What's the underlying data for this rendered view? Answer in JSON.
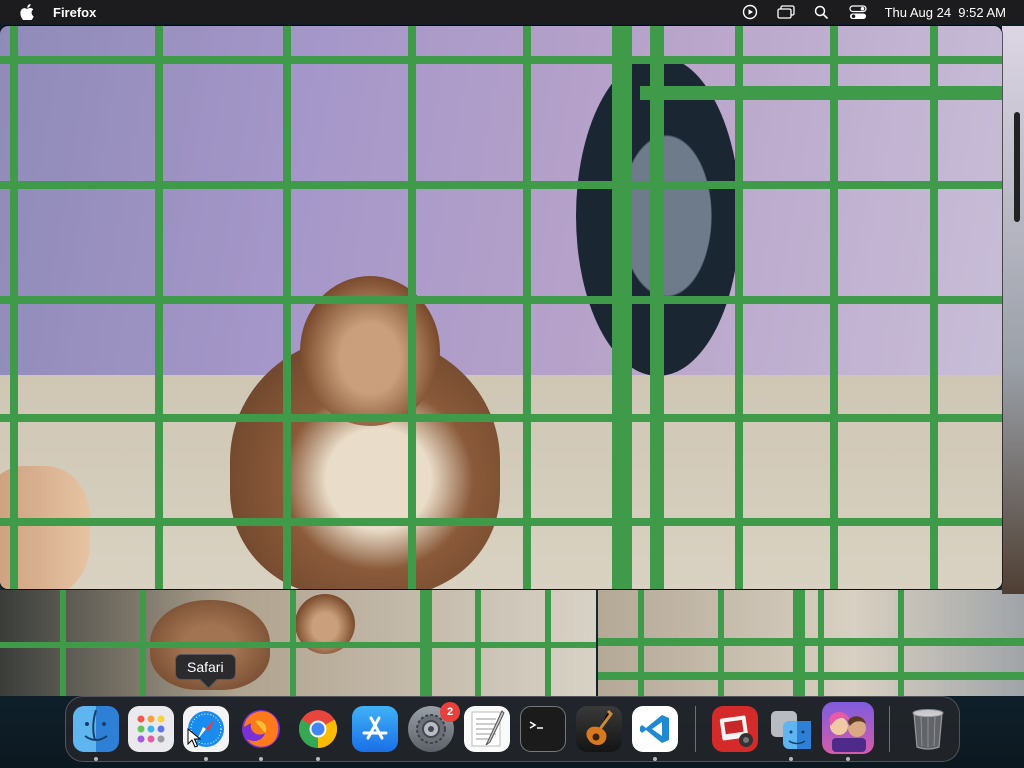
{
  "menubar": {
    "app_name": "Firefox",
    "datetime": "Thu Aug 24  9:52 AM",
    "icons": [
      "apple-icon",
      "play-circle-icon",
      "screen-mirroring-icon",
      "search-icon",
      "control-center-icon"
    ]
  },
  "tooltip": {
    "text": "Safari"
  },
  "dock": {
    "items": [
      {
        "name": "Finder",
        "icon": "finder-icon",
        "running": true
      },
      {
        "name": "Launchpad",
        "icon": "launchpad-icon",
        "running": false
      },
      {
        "name": "Safari",
        "icon": "safari-icon",
        "running": true
      },
      {
        "name": "Firefox",
        "icon": "firefox-icon",
        "running": true
      },
      {
        "name": "Google Chrome",
        "icon": "chrome-icon",
        "running": true
      },
      {
        "name": "App Store",
        "icon": "app-store-icon",
        "running": false
      },
      {
        "name": "System Settings",
        "icon": "system-settings-icon",
        "running": false,
        "badge": "2"
      },
      {
        "name": "TextEdit",
        "icon": "textedit-icon",
        "running": false
      },
      {
        "name": "Terminal",
        "icon": "terminal-icon",
        "running": false
      },
      {
        "name": "GarageBand",
        "icon": "garageband-icon",
        "running": false
      },
      {
        "name": "Visual Studio Code",
        "icon": "vscode-icon",
        "running": true
      },
      {
        "name": "Photo Booth",
        "icon": "photo-booth-icon",
        "running": false
      },
      {
        "name": "Finder (Migration)",
        "icon": "migration-assistant-icon",
        "running": true
      },
      {
        "name": "Game",
        "icon": "game-icon",
        "running": true
      },
      {
        "name": "Trash",
        "icon": "trash-icon",
        "running": false
      }
    ]
  },
  "colors": {
    "menubar": "#1c1c1e",
    "cage_green": "#3f9a4a",
    "badge_red": "#e8403a"
  }
}
